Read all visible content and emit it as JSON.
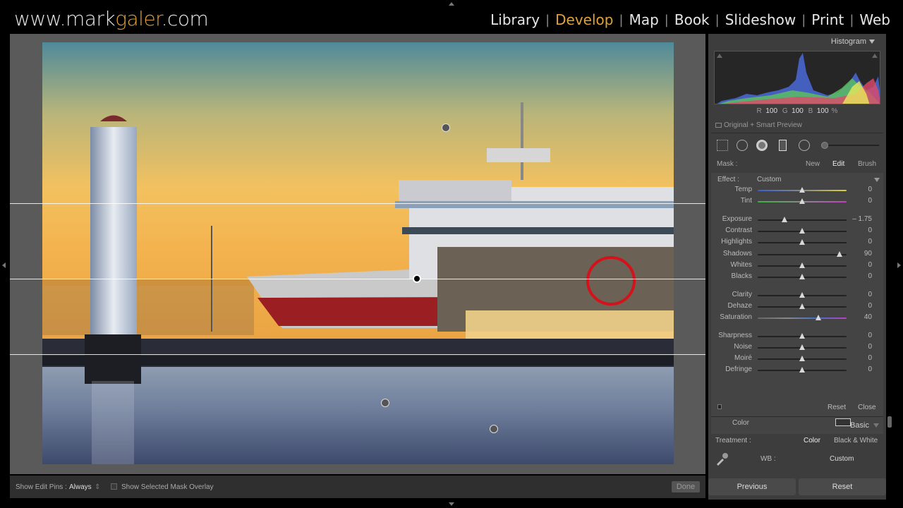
{
  "brand": {
    "prefix": "www.mark",
    "accent": "galer",
    "suffix": ".com"
  },
  "modules": [
    {
      "label": "Library",
      "active": false
    },
    {
      "label": "Develop",
      "active": true
    },
    {
      "label": "Map",
      "active": false
    },
    {
      "label": "Book",
      "active": false
    },
    {
      "label": "Slideshow",
      "active": false
    },
    {
      "label": "Print",
      "active": false
    },
    {
      "label": "Web",
      "active": false
    }
  ],
  "toolbar": {
    "show_edit_pins_label": "Show Edit Pins :",
    "show_edit_pins_value": "Always",
    "mask_overlay_label": "Show Selected Mask Overlay",
    "done_label": "Done"
  },
  "histogram": {
    "title": "Histogram",
    "r_label": "R",
    "r_value": "100",
    "g_label": "G",
    "g_value": "100",
    "b_label": "B",
    "b_value": "100",
    "percent": "%",
    "preview_label": "Original + Smart Preview"
  },
  "mask": {
    "label": "Mask :",
    "new": "New",
    "edit": "Edit",
    "brush": "Brush"
  },
  "effect": {
    "label": "Effect :",
    "value": "Custom"
  },
  "sliders": [
    {
      "label": "Temp",
      "value": "0",
      "pos": 0.5,
      "track": "temp"
    },
    {
      "label": "Tint",
      "value": "0",
      "pos": 0.5,
      "track": "tint"
    },
    {
      "label": "Exposure",
      "value": "– 1.75",
      "pos": 0.3,
      "track": "plain"
    },
    {
      "label": "Contrast",
      "value": "0",
      "pos": 0.5,
      "track": "plain"
    },
    {
      "label": "Highlights",
      "value": "0",
      "pos": 0.5,
      "track": "plain"
    },
    {
      "label": "Shadows",
      "value": "90",
      "pos": 0.92,
      "track": "plain"
    },
    {
      "label": "Whites",
      "value": "0",
      "pos": 0.5,
      "track": "plain"
    },
    {
      "label": "Blacks",
      "value": "0",
      "pos": 0.5,
      "track": "plain"
    },
    {
      "label": "Clarity",
      "value": "0",
      "pos": 0.5,
      "track": "plain"
    },
    {
      "label": "Dehaze",
      "value": "0",
      "pos": 0.5,
      "track": "plain"
    },
    {
      "label": "Saturation",
      "value": "40",
      "pos": 0.68,
      "track": "sat"
    },
    {
      "label": "Sharpness",
      "value": "0",
      "pos": 0.5,
      "track": "plain"
    },
    {
      "label": "Noise",
      "value": "0",
      "pos": 0.5,
      "track": "plain"
    },
    {
      "label": "Moiré",
      "value": "0",
      "pos": 0.5,
      "track": "plain"
    },
    {
      "label": "Defringe",
      "value": "0",
      "pos": 0.5,
      "track": "plain"
    }
  ],
  "color_label": "Color",
  "panel_footer": {
    "reset": "Reset",
    "close": "Close"
  },
  "basic": {
    "title": "Basic",
    "treatment_label": "Treatment :",
    "treatment_color": "Color",
    "treatment_bw": "Black & White",
    "wb_label": "WB :",
    "wb_value": "Custom"
  },
  "buttons": {
    "previous": "Previous",
    "reset": "Reset"
  },
  "colors": {
    "accent": "#e0a03a",
    "panel": "#3d3d3d",
    "workspace": "#5a5a5a"
  },
  "icons": [
    "graduated-filter-icon",
    "spot-removal-icon",
    "red-eye-icon",
    "crop-icon",
    "radial-filter-icon",
    "eyedropper-icon",
    "swatch-icon"
  ]
}
